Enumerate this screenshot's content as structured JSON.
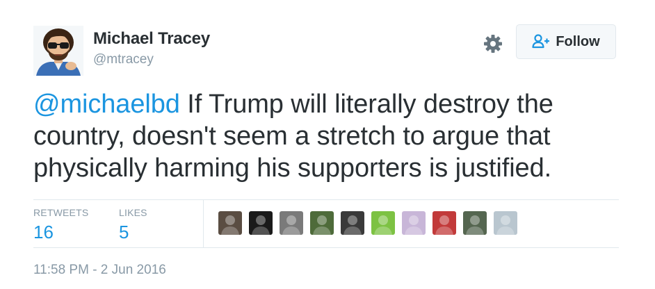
{
  "author": {
    "name": "Michael Tracey",
    "handle": "@mtracey"
  },
  "follow_button": {
    "label": "Follow",
    "icon": "add-person-icon",
    "color": "#1b95e0"
  },
  "tweet": {
    "mention": "@michaelbd",
    "text": " If Trump will literally destroy the country, doesn't seem a stretch to argue that physically harming his supporters is justified."
  },
  "stats": {
    "retweets_label": "RETWEETS",
    "retweets": "16",
    "likes_label": "LIKES",
    "likes": "5"
  },
  "likers": [
    {
      "name": "liker-avatar-1",
      "color": "#5a4d42"
    },
    {
      "name": "liker-avatar-2",
      "color": "#1a1a1a"
    },
    {
      "name": "liker-avatar-3",
      "color": "#7a7a7a"
    },
    {
      "name": "liker-avatar-4",
      "color": "#4e6b3a"
    },
    {
      "name": "liker-avatar-5",
      "color": "#3a3a3a"
    },
    {
      "name": "liker-avatar-6",
      "color": "#7dc243"
    },
    {
      "name": "liker-avatar-7",
      "color": "#c8b6d8"
    },
    {
      "name": "liker-avatar-8",
      "color": "#c23a3a"
    },
    {
      "name": "liker-avatar-9",
      "color": "#556650"
    },
    {
      "name": "liker-avatar-10",
      "color": "#b9c6cf"
    }
  ],
  "timestamp": "11:58 PM - 2 Jun 2016",
  "colors": {
    "link": "#1b95e0",
    "muted": "#8899a6",
    "text": "#292f33",
    "border": "#e1e8ed"
  }
}
